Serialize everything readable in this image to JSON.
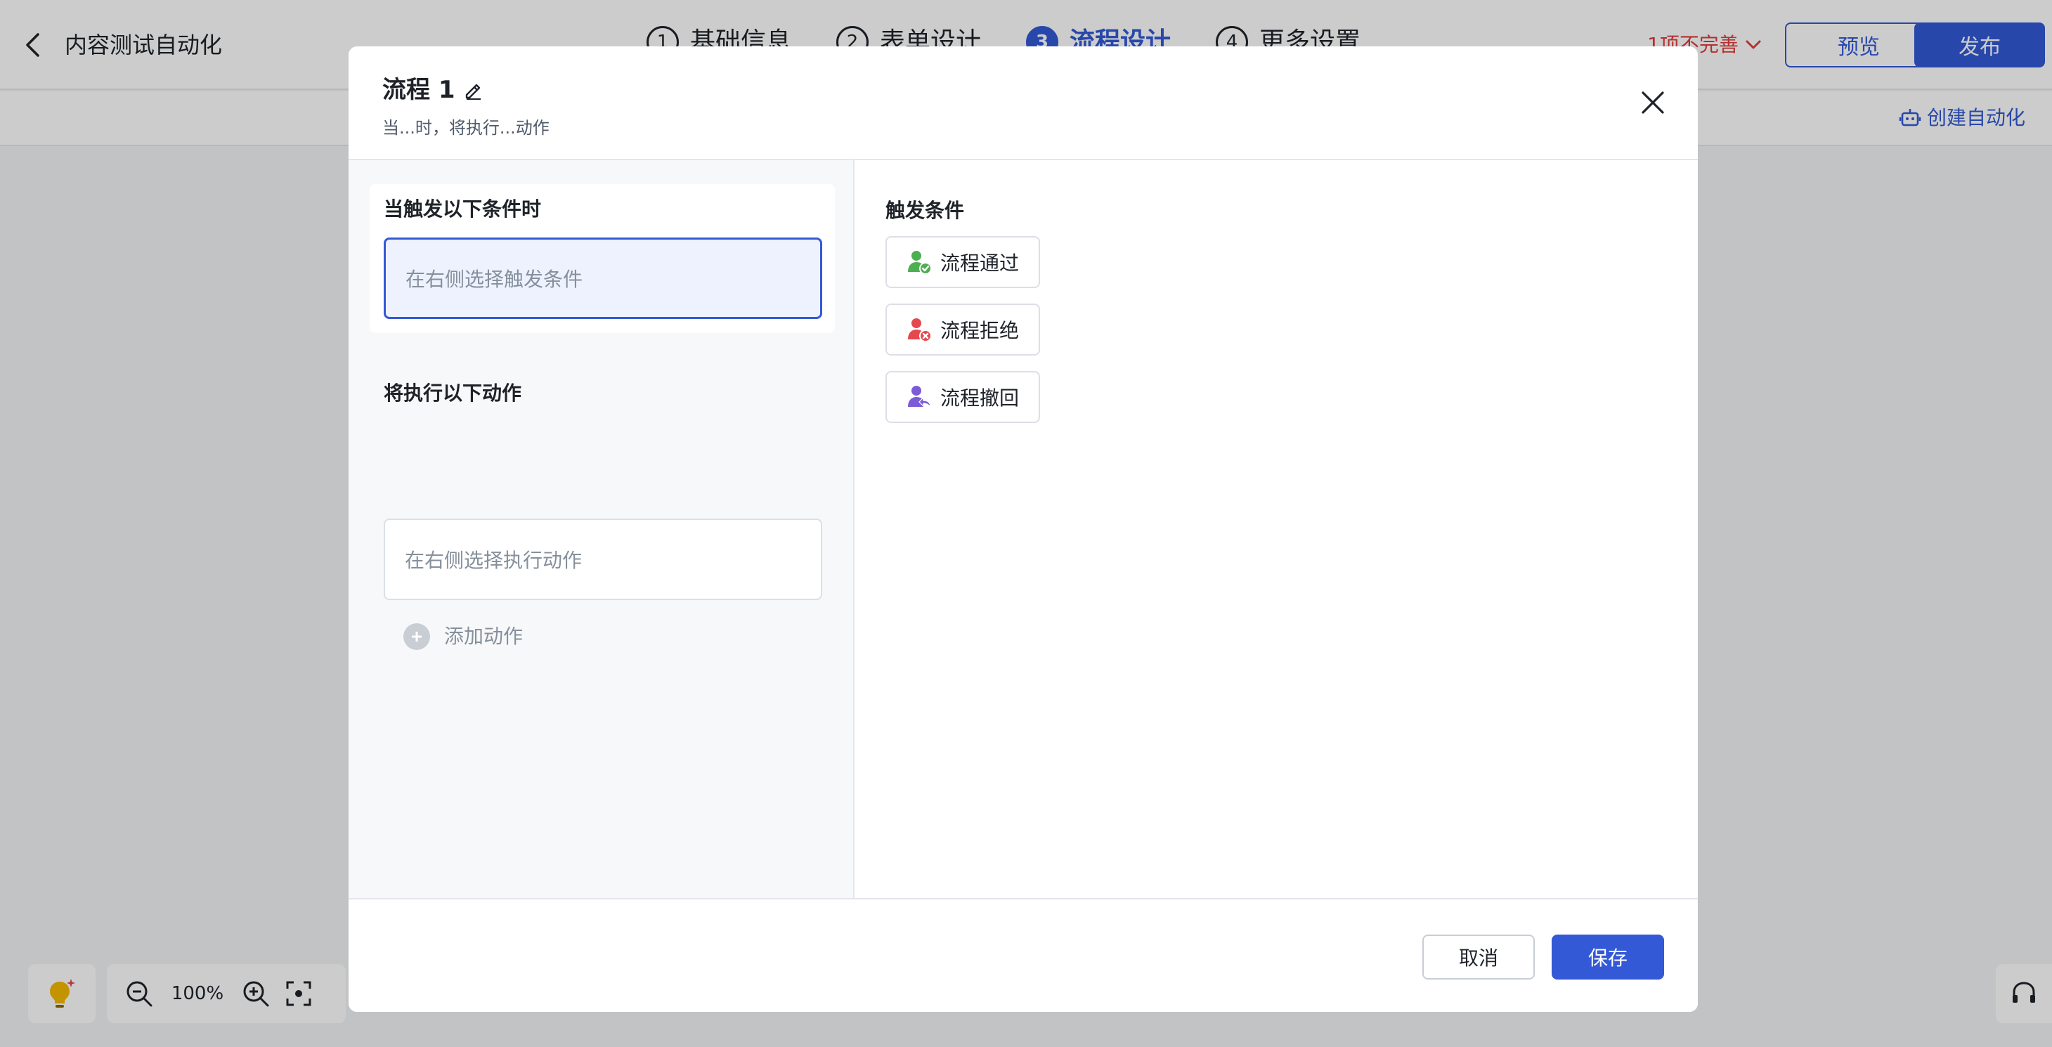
{
  "app": {
    "title": "内容测试自动化",
    "steps": [
      {
        "num": "1",
        "label": "基础信息"
      },
      {
        "num": "2",
        "label": "表单设计"
      },
      {
        "num": "3",
        "label": "流程设计"
      },
      {
        "num": "4",
        "label": "更多设置"
      }
    ],
    "incomplete_label": "1项不完善",
    "preview_label": "预览",
    "publish_label": "发布",
    "create_automation_label": "创建自动化",
    "zoom_level": "100%"
  },
  "modal": {
    "title": "流程 1",
    "subtitle": "当...时，将执行...动作",
    "trigger_section_label": "当触发以下条件时",
    "trigger_placeholder": "在右侧选择触发条件",
    "action_section_label": "将执行以下动作",
    "action_placeholder": "在右侧选择执行动作",
    "add_action_label": "添加动作",
    "conditions_title": "触发条件",
    "conditions": [
      {
        "label": "流程通过",
        "icon": "user-check-icon",
        "color": "#4caf50"
      },
      {
        "label": "流程拒绝",
        "icon": "user-reject-icon",
        "color": "#e5484d"
      },
      {
        "label": "流程撤回",
        "icon": "user-withdraw-icon",
        "color": "#7b5bd6"
      }
    ],
    "cancel_label": "取消",
    "save_label": "保存"
  },
  "colors": {
    "primary": "#3359d6",
    "danger": "#e03c3c"
  }
}
